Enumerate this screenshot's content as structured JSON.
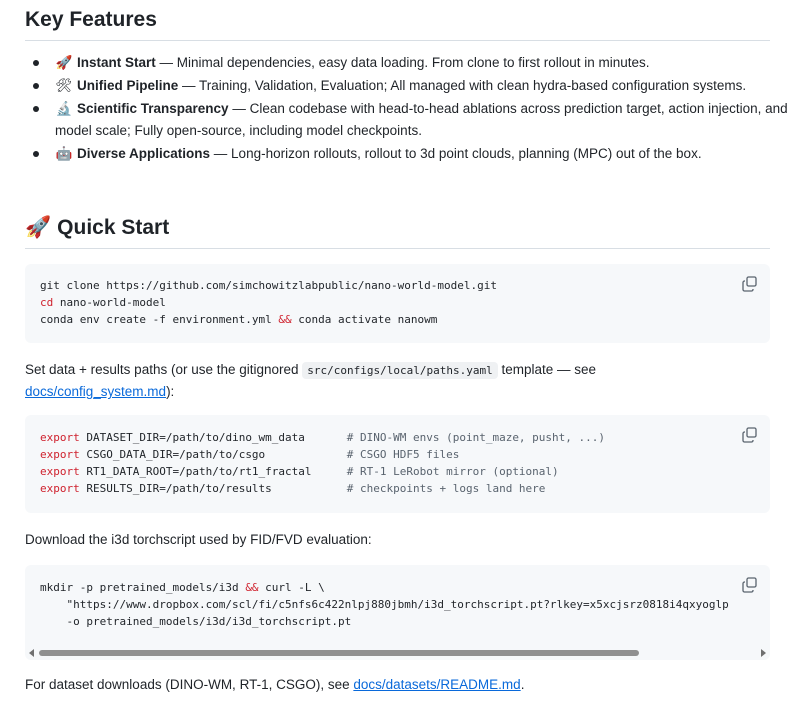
{
  "key_features": {
    "heading": "Key Features",
    "items": [
      {
        "icon": "rocket-icon",
        "emoji": "🚀",
        "name": "Instant Start",
        "desc": " — Minimal dependencies, easy data loading. From clone to first rollout in minutes."
      },
      {
        "icon": "tools-icon",
        "emoji": "🛠",
        "name": "Unified Pipeline",
        "desc": " — Training, Validation, Evaluation; All managed with clean hydra-based configuration systems."
      },
      {
        "icon": "microscope-icon",
        "emoji": "🔬",
        "name": "Scientific Transparency",
        "desc": " — Clean codebase with head-to-head ablations across prediction target, action injection, and model scale; Fully open-source, including model checkpoints."
      },
      {
        "icon": "robot-icon",
        "emoji": "🤖",
        "name": "Diverse Applications",
        "desc": " — Long-horizon rollouts, rollout to 3d point clouds, planning (MPC) out of the box."
      }
    ]
  },
  "quick_start": {
    "emoji": "🚀",
    "heading": "Quick Start",
    "code1": {
      "line1": "git clone https://github.com/simchowitzlabpublic/nano-world-model.git",
      "line2_cmd": "cd",
      "line2_rest": " nano-world-model",
      "line3_a": "conda env create -f environment.yml ",
      "line3_op": "&&",
      "line3_b": " conda activate nanowm"
    },
    "para1_a": "Set data + results paths (or use the gitignored ",
    "para1_code": "src/configs/local/paths.yaml",
    "para1_b": " template — see",
    "para1_link": "docs/config_system.md",
    "para1_c": "):",
    "code2": {
      "rows": [
        {
          "kw": "export",
          "assign": " DATASET_DIR=/path/to/dino_wm_data",
          "comment": "# DINO-WM envs (point_maze, pusht, ...)"
        },
        {
          "kw": "export",
          "assign": " CSGO_DATA_DIR=/path/to/csgo",
          "comment": "# CSGO HDF5 files"
        },
        {
          "kw": "export",
          "assign": " RT1_DATA_ROOT=/path/to/rt1_fractal",
          "comment": "# RT-1 LeRobot mirror (optional)"
        },
        {
          "kw": "export",
          "assign": " RESULTS_DIR=/path/to/results",
          "comment": "# checkpoints + logs land here"
        }
      ]
    },
    "para2": "Download the i3d torchscript used by FID/FVD evaluation:",
    "code3": {
      "line1_a": "mkdir -p pretrained_models/i3d ",
      "line1_op": "&&",
      "line1_b": " curl -L \\",
      "line2": "    \"https://www.dropbox.com/scl/fi/c5nfs6c422nlpj880jbmh/i3d_torchscript.pt?rlkey=x5xcjsrz0818i4qxyoglp",
      "line3": "    -o pretrained_models/i3d/i3d_torchscript.pt"
    },
    "para3_a": "For dataset downloads (DINO-WM, RT-1, CSGO), see ",
    "para3_link": "docs/datasets/README.md",
    "para3_b": "."
  }
}
